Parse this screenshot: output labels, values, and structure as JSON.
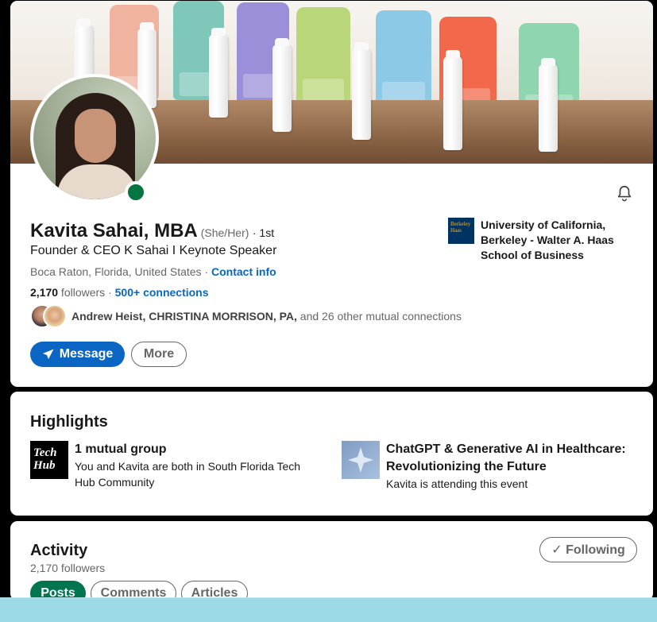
{
  "profile": {
    "name": "Kavita Sahai, MBA",
    "pronouns": "(She/Her)",
    "degree": "· 1st",
    "headline": "Founder & CEO K Sahai I Keynote Speaker",
    "location": "Boca Raton, Florida, United States",
    "location_sep": " · ",
    "contact_info": "Contact info",
    "followers_count": "2,170",
    "followers_label": " followers",
    "stats_sep": " · ",
    "connections": "500+ connections",
    "mutual_names": "Andrew Heist, CHRISTINA MORRISON, PA,",
    "mutual_rest": " and 26 other mutual connections",
    "online_status_color": "#057642",
    "buttons": {
      "message": "Message",
      "more": "More"
    },
    "education": {
      "logo_text": "Berkeley Haas",
      "name": "University of California, Berkeley - Walter A. Haas School of Business"
    },
    "banner_colors": [
      "#f0b3a0",
      "#7fc7b8",
      "#9b8fd9",
      "#b9d67a",
      "#8cc9e6",
      "#f2684a",
      "#8fd6b0"
    ]
  },
  "highlights": {
    "title": "Highlights",
    "items": [
      {
        "icon": "Tech Hub",
        "title": "1 mutual group",
        "subtitle": "You and Kavita are both in South Florida Tech Hub Community"
      },
      {
        "icon": "ai-event-icon",
        "title": "ChatGPT & Generative AI in Healthcare: Revolutionizing the Future",
        "subtitle": "Kavita is attending this event"
      }
    ]
  },
  "activity": {
    "title": "Activity",
    "followers": "2,170 followers",
    "following_button": "✓ Following",
    "chips": [
      "Posts",
      "Comments",
      "Articles"
    ]
  },
  "colors": {
    "accent": "#0a66c2",
    "posts_chip": "#01754f",
    "page_bg": "#000000",
    "bottom_bar": "#9cd9e6"
  }
}
